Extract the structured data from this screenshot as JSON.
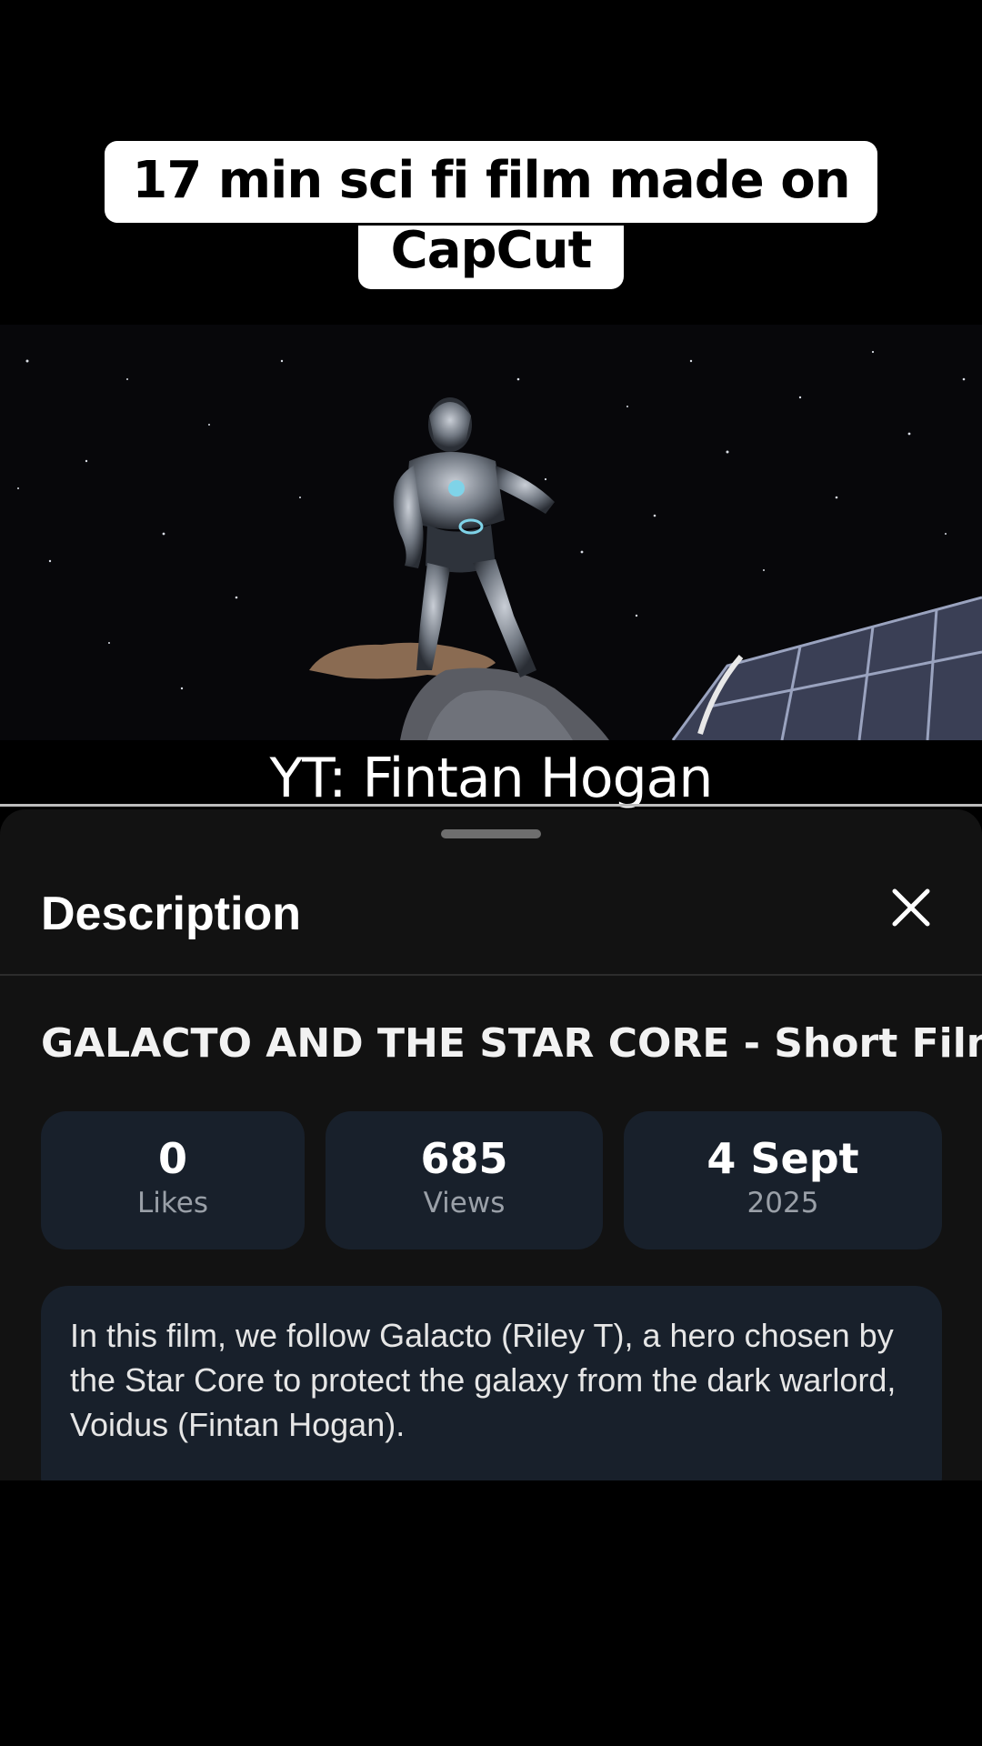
{
  "caption": {
    "line1": "17 min sci fi film made on",
    "line2": "CapCut"
  },
  "video": {
    "credit": "YT: Fintan Hogan"
  },
  "sheet": {
    "title": "Description",
    "video_title": "GALACTO AND THE STAR CORE - Short Film",
    "stats": {
      "likes": {
        "value": "0",
        "label": "Likes"
      },
      "views": {
        "value": "685",
        "label": "Views"
      },
      "date": {
        "value": "4 Sept",
        "label": "2025"
      }
    },
    "description": "In this film, we follow Galacto (Riley T), a hero chosen by the Star Core to protect the galaxy from the dark warlord, Voidus (Fintan Hogan)."
  },
  "icons": {
    "close": "close-icon",
    "handle": "drag-handle"
  },
  "colors": {
    "sheet_bg": "#121212",
    "card_bg": "#18202b",
    "caption_bg": "#ffffff"
  }
}
